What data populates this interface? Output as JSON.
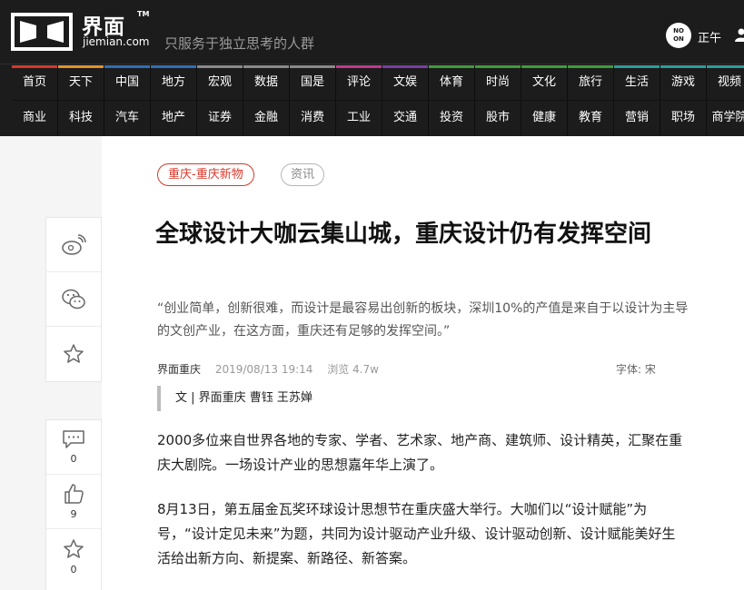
{
  "header": {
    "logo_cn": "界面",
    "logo_tm": "TM",
    "logo_en": "jiemian.com",
    "slogan": "只服务于独立思考的人群",
    "noon_badge_top": "NO",
    "noon_badge_bottom": "ON",
    "noon_label": "正午"
  },
  "nav": {
    "row1": [
      {
        "label": "首页",
        "color": "#d9372b"
      },
      {
        "label": "天下",
        "color": "#e0912a"
      },
      {
        "label": "中国",
        "color": "#2f6fb8"
      },
      {
        "label": "地方",
        "color": "#2f6fb8"
      },
      {
        "label": "宏观",
        "color": "#8a8a8a"
      },
      {
        "label": "数据",
        "color": "#8a8a8a"
      },
      {
        "label": "国是",
        "color": "#8a8a8a"
      },
      {
        "label": "评论",
        "color": "#c23a8e"
      },
      {
        "label": "文娱",
        "color": "#7a3ea1"
      },
      {
        "label": "体育",
        "color": "#3f9c3a"
      },
      {
        "label": "时尚",
        "color": "#3f9c3a"
      },
      {
        "label": "文化",
        "color": "#3f9c3a"
      },
      {
        "label": "旅行",
        "color": "#3f9c3a"
      },
      {
        "label": "生活",
        "color": "#2a9d9a"
      },
      {
        "label": "游戏",
        "color": "#2a9d9a"
      },
      {
        "label": "视频",
        "color": "#2a9d9a"
      }
    ],
    "row2": [
      "商业",
      "科技",
      "汽车",
      "地产",
      "证券",
      "金融",
      "消费",
      "工业",
      "交通",
      "投资",
      "股市",
      "健康",
      "教育",
      "营销",
      "职场",
      "商学院"
    ]
  },
  "rail": {
    "weibo_icon": "weibo-icon",
    "wechat_icon": "wechat-icon",
    "favorite_icon": "star-icon",
    "comment_count": "0",
    "like_count": "9",
    "collect_count": "0"
  },
  "article": {
    "tag_primary": "重庆-重庆新物",
    "tag_secondary": "资讯",
    "title": "全球设计大咖云集山城，重庆设计仍有发挥空间",
    "summary": "“创业简单，创新很难，而设计是最容易出创新的板块，深圳10%的产值是来自于以设计为主导的文创产业，在这方面，重庆还有足够的发挥空间。”",
    "source": "界面重庆",
    "date": "2019/08/13 19:14",
    "views": "浏览 4.7w",
    "font_label": "字体:",
    "font_value": "宋",
    "author_line": "文 | 界面重庆 曹钰 王苏婵",
    "paragraphs": [
      "2000多位来自世界各地的专家、学者、艺术家、地产商、建筑师、设计精英，汇聚在重庆大剧院。一场设计产业的思想嘉年华上演了。",
      "8月13日，第五届金瓦奖环球设计思想节在重庆盛大举行。大咖们以“设计赋能”为号，“设计定见未来”为题，共同为设计驱动产业升级、设计驱动创新、设计赋能美好生活给出新方向、新提案、新路径、新答案。"
    ]
  },
  "colors": {
    "header_bg": "#1c1c1c",
    "accent_red": "#d9372b"
  }
}
